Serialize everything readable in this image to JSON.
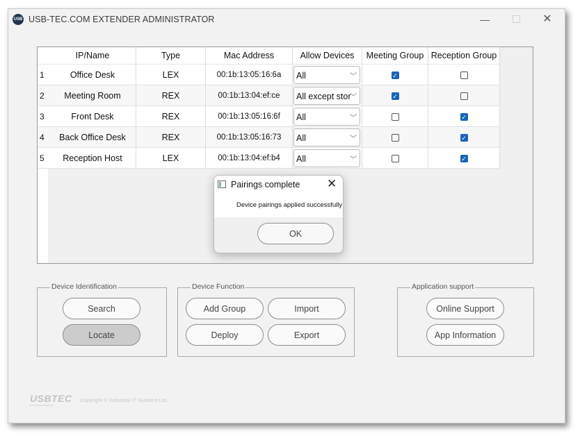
{
  "window": {
    "title": "USB-TEC.COM EXTENDER ADMINISTRATOR",
    "icon_label": "USB",
    "minimize_glyph": "—",
    "close_glyph": "✕"
  },
  "table": {
    "headers": [
      "IP/Name",
      "Type",
      "Mac Address",
      "Allow Devices",
      "Meeting Group",
      "Reception Group"
    ],
    "rows": [
      {
        "num": "1",
        "name": "Office Desk",
        "type": "LEX",
        "mac": "00:1b:13:05:16:6a",
        "allow": "All",
        "meeting": true,
        "reception": false
      },
      {
        "num": "2",
        "name": "Meeting Room",
        "type": "REX",
        "mac": "00:1b:13:04:ef:ce",
        "allow": "All except stor",
        "meeting": true,
        "reception": false
      },
      {
        "num": "3",
        "name": "Front Desk",
        "type": "REX",
        "mac": "00:1b:13:05:16:6f",
        "allow": "All",
        "meeting": false,
        "reception": true
      },
      {
        "num": "4",
        "name": "Back Office Desk",
        "type": "REX",
        "mac": "00:1b:13:05:16:73",
        "allow": "All",
        "meeting": false,
        "reception": true
      },
      {
        "num": "5",
        "name": "Reception Host",
        "type": "LEX",
        "mac": "00:1b:13:04:ef:b4",
        "allow": "All",
        "meeting": false,
        "reception": true
      }
    ]
  },
  "dialog": {
    "title": "Pairings complete",
    "message": "Device pairings applied successfully",
    "ok_label": "OK",
    "close_glyph": "✕"
  },
  "groups": {
    "identification": {
      "title": "Device Identification",
      "search": "Search",
      "locate": "Locate"
    },
    "function": {
      "title": "Device Function",
      "add_group": "Add Group",
      "import": "Import",
      "deploy": "Deploy",
      "export": "Export"
    },
    "support": {
      "title": "Application support",
      "online": "Online Support",
      "info": "App Information"
    }
  },
  "footer": {
    "logo": "USBTEC",
    "logo_sub": "universal serial bus",
    "copyright": "Copyright © Industrial IT Systems Ltd."
  },
  "colors": {
    "checkbox_checked": "#1a64b8",
    "window_bg": "#f2f2f2"
  }
}
